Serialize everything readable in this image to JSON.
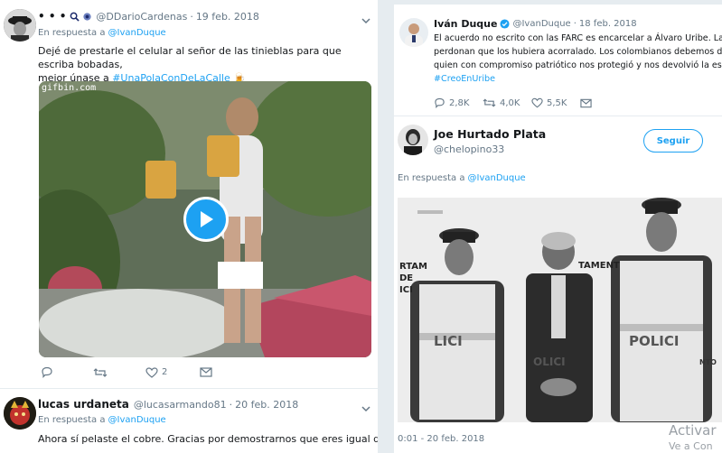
{
  "left": {
    "tweet1": {
      "name": "• • •",
      "handle": "@DDarioCardenas",
      "date": "19 feb. 2018",
      "reply_prefix": "En respuesta a",
      "reply_to": "@IvanDuque",
      "text_line1": "Dejé de prestarle el celular al señor de las tinieblas para que escriba bobadas,",
      "text_line2_prefix": "mejor únase a",
      "hashtag": "#UnaPolaConDeLaCalle",
      "emoji": "🍺",
      "media_watermark": "gifbin.com",
      "likes": "2"
    },
    "tweet2": {
      "name": "lucas urdaneta",
      "handle": "@lucasarmando81",
      "date": "20 feb. 2018",
      "reply_prefix": "En respuesta a",
      "reply_to": "@IvanDuque",
      "text": "Ahora sí pelaste el cobre. Gracias por demostrarnos que eres igual de uribestia a"
    }
  },
  "right": {
    "quoted": {
      "name": "Iván Duque",
      "handle": "@IvanDuque",
      "date": "18 feb. 2018",
      "text_line1": "El acuerdo no escrito con las FARC es encarcelar a Álvaro Uribe. Las FARC no le",
      "text_line2": "perdonan que los hubiera acorralado. Los colombianos debemos defender a",
      "text_line3": "quien con compromiso patriótico nos protegió y nos devolvió la esperanza.",
      "hashtag": "#CreoEnUribe",
      "replies": "2,8K",
      "retweets": "4,0K",
      "likes": "5,5K"
    },
    "author": {
      "name": "Joe Hurtado Plata",
      "handle": "@chelopino33",
      "follow_label": "Seguir",
      "reply_prefix": "En respuesta a",
      "reply_to": "@IvanDuque"
    },
    "media": {
      "wall_text_left": "RTAM",
      "wall_text_left2": "DE",
      "wall_text_left3": "ICI",
      "wall_text_right": "TAMENT",
      "vest_text1": "LICI",
      "vest_text2": "OLICI",
      "vest_text3": "POLICI",
      "wall_text_right2": "NTO",
      "timestamp": "0:01 - 20 feb. 2018"
    },
    "watermark_line1": "Activar",
    "watermark_line2": "Ve a Con"
  },
  "colors": {
    "link": "#1da1f2",
    "secondary_text": "#657786",
    "divider": "#e6ecf0",
    "play_button": "#1da1f2"
  }
}
